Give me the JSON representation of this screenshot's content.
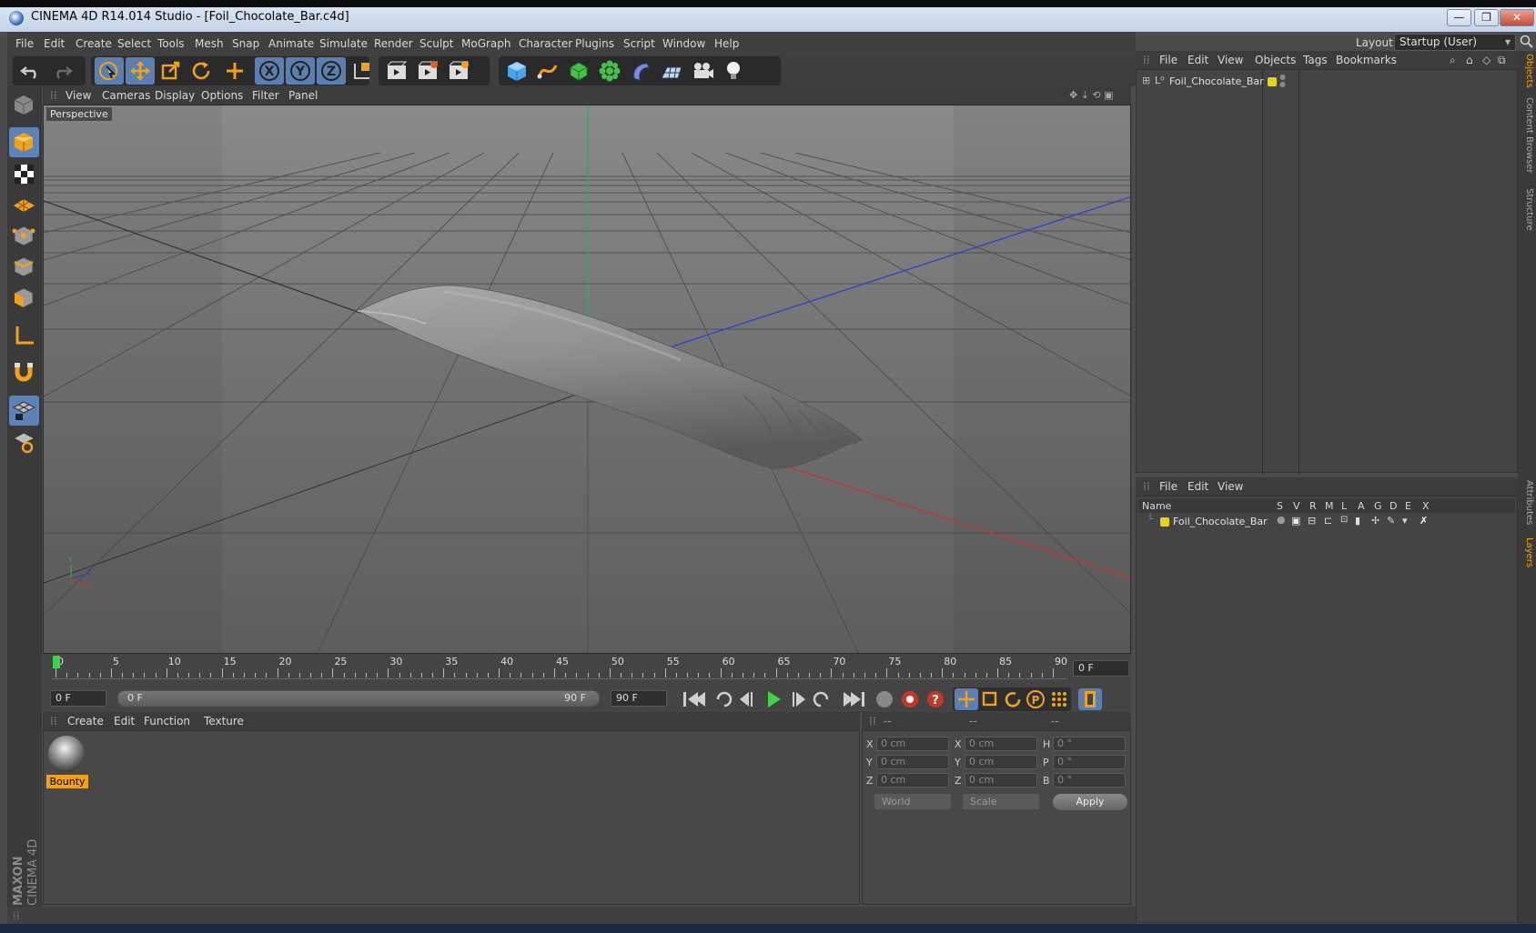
{
  "window": {
    "title": "CINEMA 4D R14.014 Studio - [Foil_Chocolate_Bar.c4d]",
    "minimize": "—",
    "restore": "❐",
    "close": "✕"
  },
  "menu": [
    "File",
    "Edit",
    "Create",
    "Select",
    "Tools",
    "Mesh",
    "Snap",
    "Animate",
    "Simulate",
    "Render",
    "Sculpt",
    "MoGraph",
    "Character",
    "Plugins",
    "Script",
    "Window",
    "Help"
  ],
  "layout": {
    "label": "Layout:",
    "value": "Startup (User)"
  },
  "viewport": {
    "menu": [
      "View",
      "Cameras",
      "Display",
      "Options",
      "Filter",
      "Panel"
    ],
    "label": "Perspective"
  },
  "timeline": {
    "ticks": [
      "0",
      "5",
      "10",
      "15",
      "20",
      "25",
      "30",
      "35",
      "40",
      "45",
      "50",
      "55",
      "60",
      "65",
      "70",
      "75",
      "80",
      "85",
      "90"
    ],
    "current_frame": "0 F",
    "start_field": "0 F",
    "range_start": "0 F",
    "range_end": "90 F",
    "end_field": "90 F"
  },
  "materials": {
    "menu": [
      "Create",
      "Edit",
      "Function",
      "Texture"
    ],
    "items": [
      {
        "name": "Bounty"
      }
    ]
  },
  "coordinates": {
    "header": [
      "--",
      "--",
      "--"
    ],
    "rows": [
      {
        "l1": "X",
        "v1": "0 cm",
        "l2": "X",
        "v2": "0 cm",
        "l3": "H",
        "v3": "0 °"
      },
      {
        "l1": "Y",
        "v1": "0 cm",
        "l2": "Y",
        "v2": "0 cm",
        "l3": "P",
        "v3": "0 °"
      },
      {
        "l1": "Z",
        "v1": "0 cm",
        "l2": "Z",
        "v2": "0 cm",
        "l3": "B",
        "v3": "0 °"
      }
    ],
    "mode": "World",
    "transform": "Scale",
    "apply": "Apply"
  },
  "objects": {
    "menu": [
      "File",
      "Edit",
      "View",
      "Objects",
      "Tags",
      "Bookmarks"
    ],
    "items": [
      {
        "name": "Foil_Chocolate_Bar",
        "color": "#e7d21a"
      }
    ]
  },
  "layers": {
    "menu": [
      "File",
      "Edit",
      "View"
    ],
    "columns": [
      "Name",
      "S",
      "V",
      "R",
      "M",
      "L",
      "A",
      "G",
      "D",
      "E",
      "X"
    ],
    "items": [
      {
        "name": "Foil_Chocolate_Bar",
        "color": "#e7d21a"
      }
    ]
  },
  "dock_tabs": [
    "Objects",
    "Content Browser",
    "Structure",
    "Attributes",
    "Layers"
  ],
  "branding": {
    "line1": "MAXON",
    "line2": "CINEMA 4D"
  },
  "colors": {
    "accent": "#f0a21c",
    "selection": "#5c7fb0",
    "x_axis": "#c0392b",
    "y_axis": "#27ae60",
    "z_axis": "#3340c8"
  }
}
